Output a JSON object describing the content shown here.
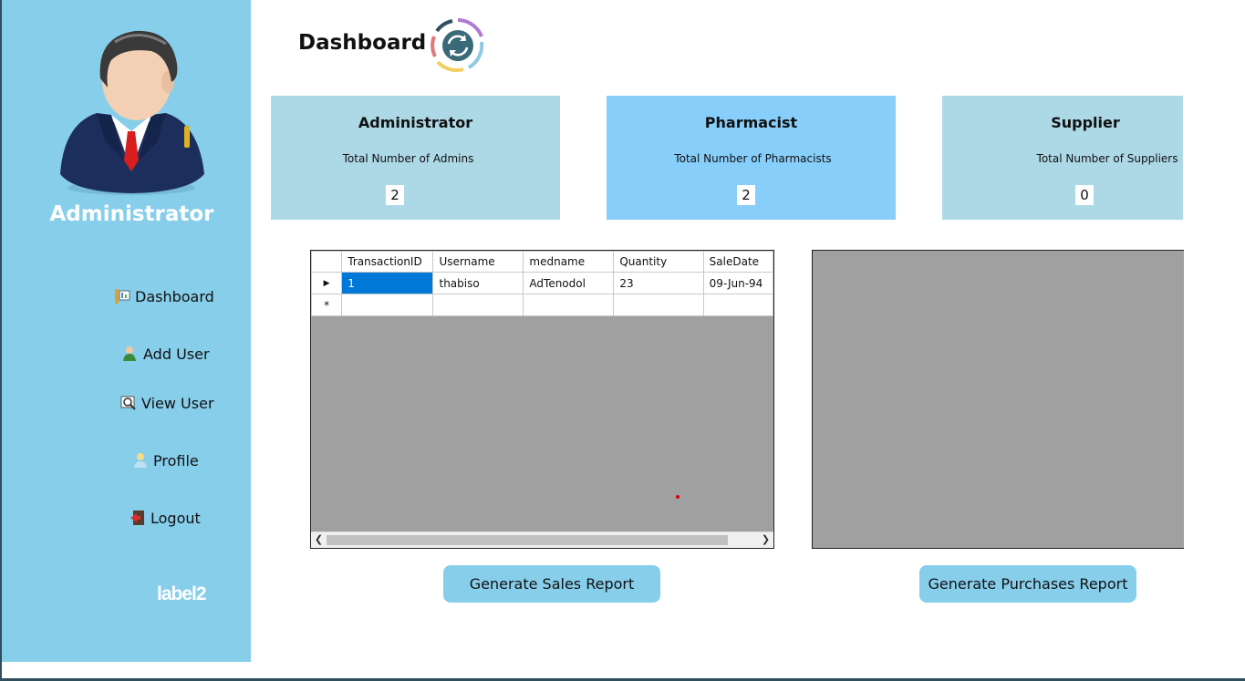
{
  "sidebar": {
    "title": "Administrator",
    "nav": [
      {
        "label": "Dashboard",
        "icon": "dashboard-icon"
      },
      {
        "label": "Add User",
        "icon": "add-user-icon"
      },
      {
        "label": "View User",
        "icon": "view-user-icon"
      },
      {
        "label": "Profile",
        "icon": "profile-icon"
      },
      {
        "label": "Logout",
        "icon": "logout-icon"
      }
    ],
    "footer_label": "label2"
  },
  "header": {
    "title": "Dashboard",
    "icon": "sync-icon"
  },
  "cards": [
    {
      "title": "Administrator",
      "subtitle": "Total Number of Admins",
      "value": "2",
      "color": "#add8e6"
    },
    {
      "title": "Pharmacist",
      "subtitle": "Total Number of Pharmacists",
      "value": "2",
      "color": "#87cefa"
    },
    {
      "title": "Supplier",
      "subtitle": "Total Number of Suppliers",
      "value": "0",
      "color": "#add8e6"
    }
  ],
  "sales_grid": {
    "columns": [
      "TransactionID",
      "Username",
      "medname",
      "Quantity",
      "SaleDate"
    ],
    "rows": [
      [
        "1",
        "thabiso",
        "AdTenodol",
        "23",
        "09-Jun-94"
      ]
    ],
    "new_row_marker": "*",
    "current_row_marker": "▶"
  },
  "buttons": {
    "sales_report": "Generate Sales Report",
    "purchases_report": "Generate Purchases Report"
  },
  "colors": {
    "sidebar": "#87ceeb",
    "grid_background": "#a0a0a0",
    "selection": "#0078d7"
  }
}
